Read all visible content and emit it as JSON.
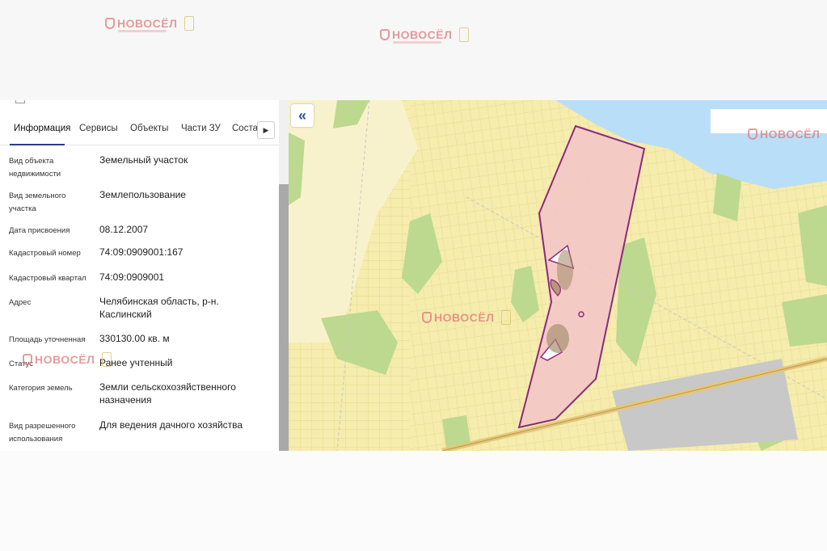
{
  "watermark": {
    "brand": "НОВОСЁЛ"
  },
  "panel": {
    "tabs": [
      {
        "label": "Информация",
        "active": true
      },
      {
        "label": "Сервисы"
      },
      {
        "label": "Объекты"
      },
      {
        "label": "Части ЗУ"
      },
      {
        "label": "Состав"
      }
    ],
    "next_icon": "chevron-right-icon",
    "fields": [
      {
        "label": "Вид объекта недвижимости",
        "value": "Земельный участок"
      },
      {
        "label": "Вид земельного участка",
        "value": "Землепользование"
      },
      {
        "label": "Дата присвоения",
        "value": "08.12.2007"
      },
      {
        "label": "Кадастровый номер",
        "value": "74:09:0909001:167"
      },
      {
        "label": "Кадастровый квартал",
        "value": "74:09:0909001"
      },
      {
        "label": "Адрес",
        "value": "Челябинская область, р-н. Каслинский"
      },
      {
        "label": "Площадь уточненная",
        "value": "330130.00 кв. м"
      },
      {
        "label": "Статус",
        "value": "Ранее учтенный"
      },
      {
        "label": "Категория земель",
        "value": "Земли сельскохозяйственного назначения"
      },
      {
        "label": "Вид разрешенного использования",
        "value": "Для ведения дачного хозяйства"
      }
    ]
  },
  "map": {
    "collapse_icon": "double-chevron-left-icon",
    "collapse_glyph": "«",
    "colors": {
      "background": "#f5ecae",
      "water": "#b9def8",
      "forest": "#bcd98f",
      "parcel_fill": "#f2c5c8",
      "parcel_stroke": "#8b2a7c",
      "road": "#e6c77a",
      "grey_zone": "#c8c8c8"
    }
  }
}
